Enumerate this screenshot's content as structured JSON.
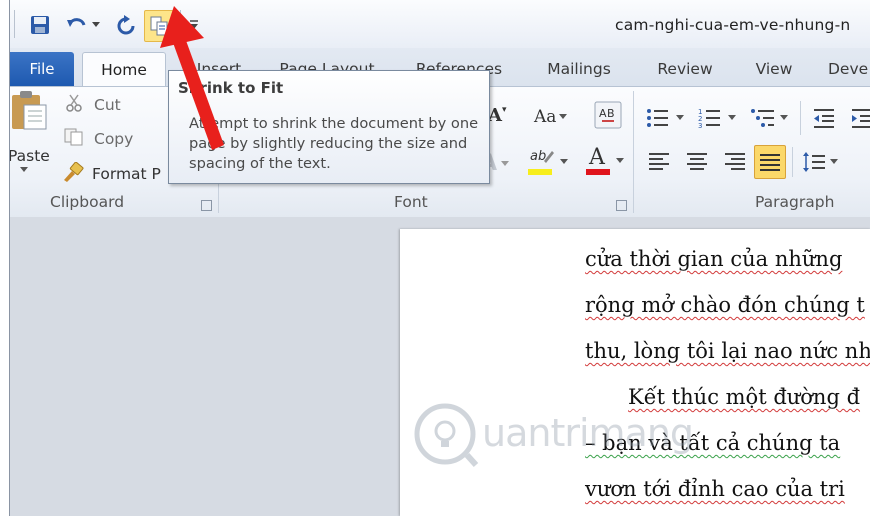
{
  "window": {
    "title": "cam-nghi-cua-em-ve-nhung-n"
  },
  "qat": {
    "items": [
      "save-icon",
      "undo-icon",
      "undo-dropdown-icon",
      "redo-icon",
      "shrink-to-fit-icon",
      "customize-qat-icon"
    ]
  },
  "tabs": {
    "file": "File",
    "home": "Home",
    "insert": "Insert",
    "page_layout": "Page Layout",
    "references": "References",
    "mailings": "Mailings",
    "review": "Review",
    "view": "View",
    "developer": "Deve"
  },
  "clipboard": {
    "paste": "Paste",
    "cut": "Cut",
    "copy": "Copy",
    "format_painter": "Format P",
    "group_label": "Clipboard"
  },
  "font": {
    "group_label": "Font",
    "change_case": "Aa"
  },
  "paragraph": {
    "group_label": "Paragraph"
  },
  "tooltip": {
    "title": "Shrink to Fit",
    "body": "Attempt to shrink the document by one page by slightly reducing the size and spacing of the text."
  },
  "document": {
    "lines": [
      "cửa thời gian của những",
      "rộng mở chào đón chúng t",
      "thu, lòng tôi lại nao nức nh",
      "Kết thúc một đường đ",
      "– bạn và tất cả chúng ta",
      "vươn tới đỉnh cao của tri"
    ]
  },
  "watermark": {
    "text": "uantrimang"
  },
  "colors": {
    "file_tab": "#2a64b8",
    "arrow": "#e8201c",
    "spell_error": "#d23a3a",
    "grammar_error": "#3aa14a"
  }
}
